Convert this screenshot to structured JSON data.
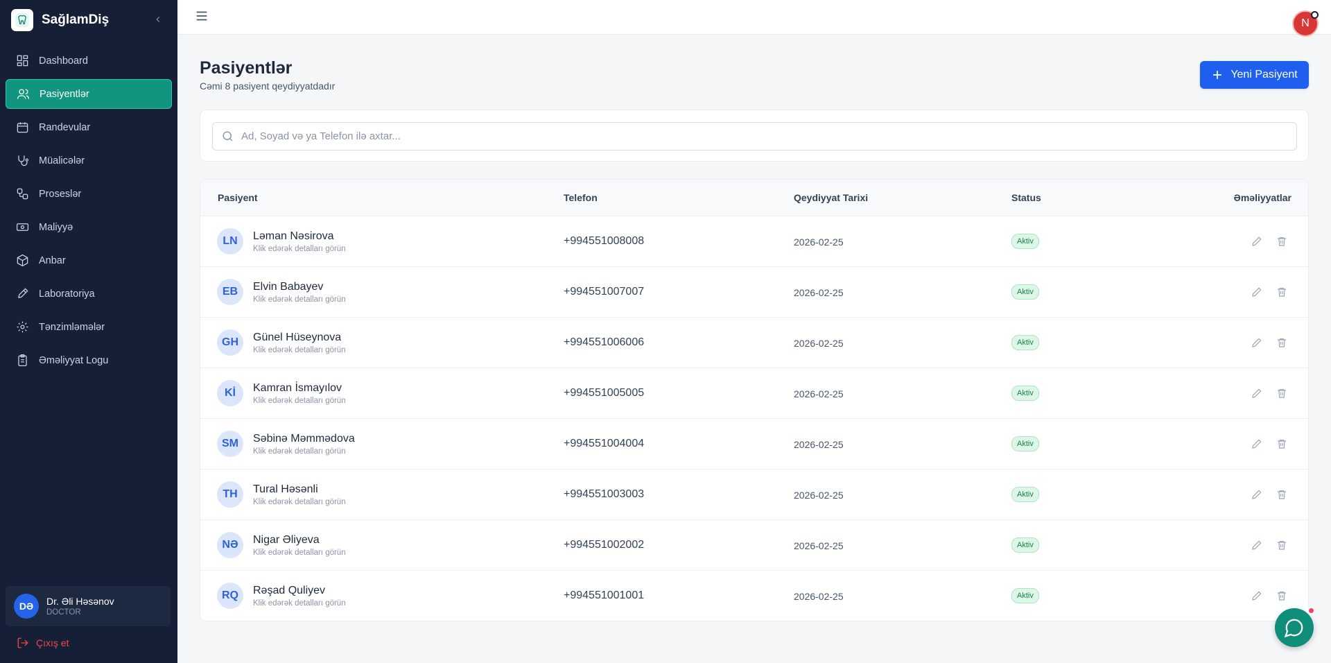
{
  "app": {
    "name": "SağlamDiş"
  },
  "sidebar": {
    "items": [
      {
        "label": "Dashboard",
        "icon": "dashboard-icon",
        "active": false
      },
      {
        "label": "Pasiyentlər",
        "icon": "users-icon",
        "active": true
      },
      {
        "label": "Randevular",
        "icon": "calendar-icon",
        "active": false
      },
      {
        "label": "Müalicələr",
        "icon": "stethoscope-icon",
        "active": false
      },
      {
        "label": "Proseslər",
        "icon": "workflow-icon",
        "active": false
      },
      {
        "label": "Maliyyə",
        "icon": "banknote-icon",
        "active": false
      },
      {
        "label": "Anbar",
        "icon": "box-icon",
        "active": false
      },
      {
        "label": "Laboratoriya",
        "icon": "pipette-icon",
        "active": false
      },
      {
        "label": "Tənzimləmələr",
        "icon": "gear-icon",
        "active": false
      },
      {
        "label": "Əməliyyat Logu",
        "icon": "clipboard-icon",
        "active": false
      }
    ],
    "user": {
      "initials": "DƏ",
      "name": "Dr. Əli Həsənov",
      "role": "DOCTOR"
    },
    "logout_label": "Çıxış et"
  },
  "topbar": {
    "avatar_initial": "N"
  },
  "page": {
    "title": "Pasiyentlər",
    "subtitle": "Cəmi 8 pasiyent qeydiyyatdadır",
    "new_button": "Yeni Pasiyent"
  },
  "search": {
    "placeholder": "Ad, Soyad və ya Telefon ilə axtar...",
    "value": ""
  },
  "table": {
    "headers": {
      "patient": "Pasiyent",
      "phone": "Telefon",
      "date": "Qeydiyyat Tarixi",
      "status": "Status",
      "actions": "Əməliyyatlar"
    },
    "rows": [
      {
        "initials": "LN",
        "name": "Ləman Nəsirova",
        "hint": "Klik edərək detalları görün",
        "phone": "+994551008008",
        "date": "2026-02-25",
        "status": "Aktiv"
      },
      {
        "initials": "EB",
        "name": "Elvin Babayev",
        "hint": "Klik edərək detalları görün",
        "phone": "+994551007007",
        "date": "2026-02-25",
        "status": "Aktiv"
      },
      {
        "initials": "GH",
        "name": "Günel Hüseynova",
        "hint": "Klik edərək detalları görün",
        "phone": "+994551006006",
        "date": "2026-02-25",
        "status": "Aktiv"
      },
      {
        "initials": "Kİ",
        "name": "Kamran İsmayılov",
        "hint": "Klik edərək detalları görün",
        "phone": "+994551005005",
        "date": "2026-02-25",
        "status": "Aktiv"
      },
      {
        "initials": "SM",
        "name": "Səbinə Məmmədova",
        "hint": "Klik edərək detalları görün",
        "phone": "+994551004004",
        "date": "2026-02-25",
        "status": "Aktiv"
      },
      {
        "initials": "TH",
        "name": "Tural Həsənli",
        "hint": "Klik edərək detalları görün",
        "phone": "+994551003003",
        "date": "2026-02-25",
        "status": "Aktiv"
      },
      {
        "initials": "NƏ",
        "name": "Nigar Əliyeva",
        "hint": "Klik edərək detalları görün",
        "phone": "+994551002002",
        "date": "2026-02-25",
        "status": "Aktiv"
      },
      {
        "initials": "RQ",
        "name": "Rəşad Quliyev",
        "hint": "Klik edərək detalları görün",
        "phone": "+994551001001",
        "date": "2026-02-25",
        "status": "Aktiv"
      }
    ]
  },
  "colors": {
    "sidebar_bg": "#152036",
    "active": "#12957e",
    "primary": "#1f5ff0",
    "status_green": "#18804a",
    "logout_red": "#f04848"
  }
}
